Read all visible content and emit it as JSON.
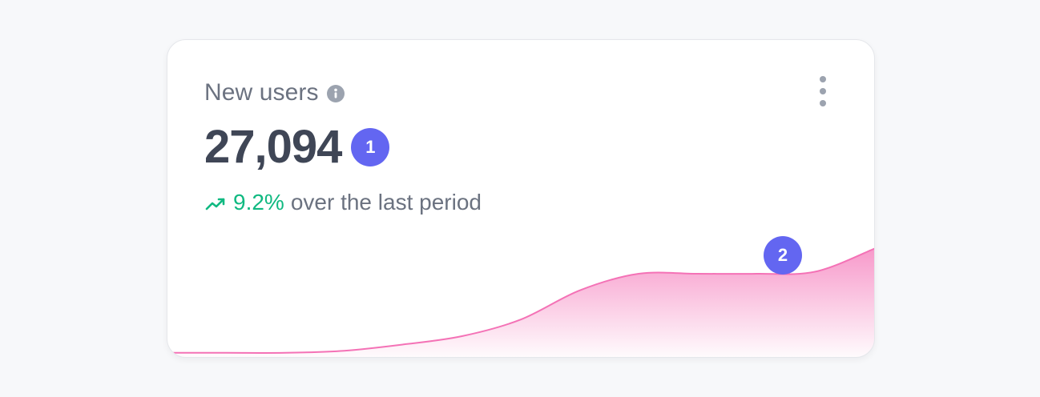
{
  "card": {
    "title": "New users",
    "info_icon": "info-icon",
    "menu_icon": "vertical-dots-icon",
    "value": "27,094",
    "marker_one": "1",
    "trend_icon": "trending-up-icon",
    "trend_value": "9.2%",
    "trend_text": "over the last period",
    "marker_two": "2"
  },
  "colors": {
    "accent": "#6366f1",
    "positive": "#10b981",
    "chart_fill": "#f472b6",
    "text_primary": "#3f4656",
    "text_secondary": "#6b7280"
  },
  "chart_data": {
    "type": "area",
    "title": "",
    "xlabel": "",
    "ylabel": "",
    "x": [
      0,
      1,
      2,
      3,
      4,
      5,
      6,
      7,
      8,
      9,
      10,
      11,
      12
    ],
    "series": [
      {
        "name": "",
        "values": [
          2,
          2,
          2,
          3,
          6,
          10,
          18,
          32,
          40,
          40,
          40,
          41,
          52
        ]
      }
    ],
    "ylim": [
      0,
      60
    ],
    "grid": false,
    "legend": "none"
  }
}
